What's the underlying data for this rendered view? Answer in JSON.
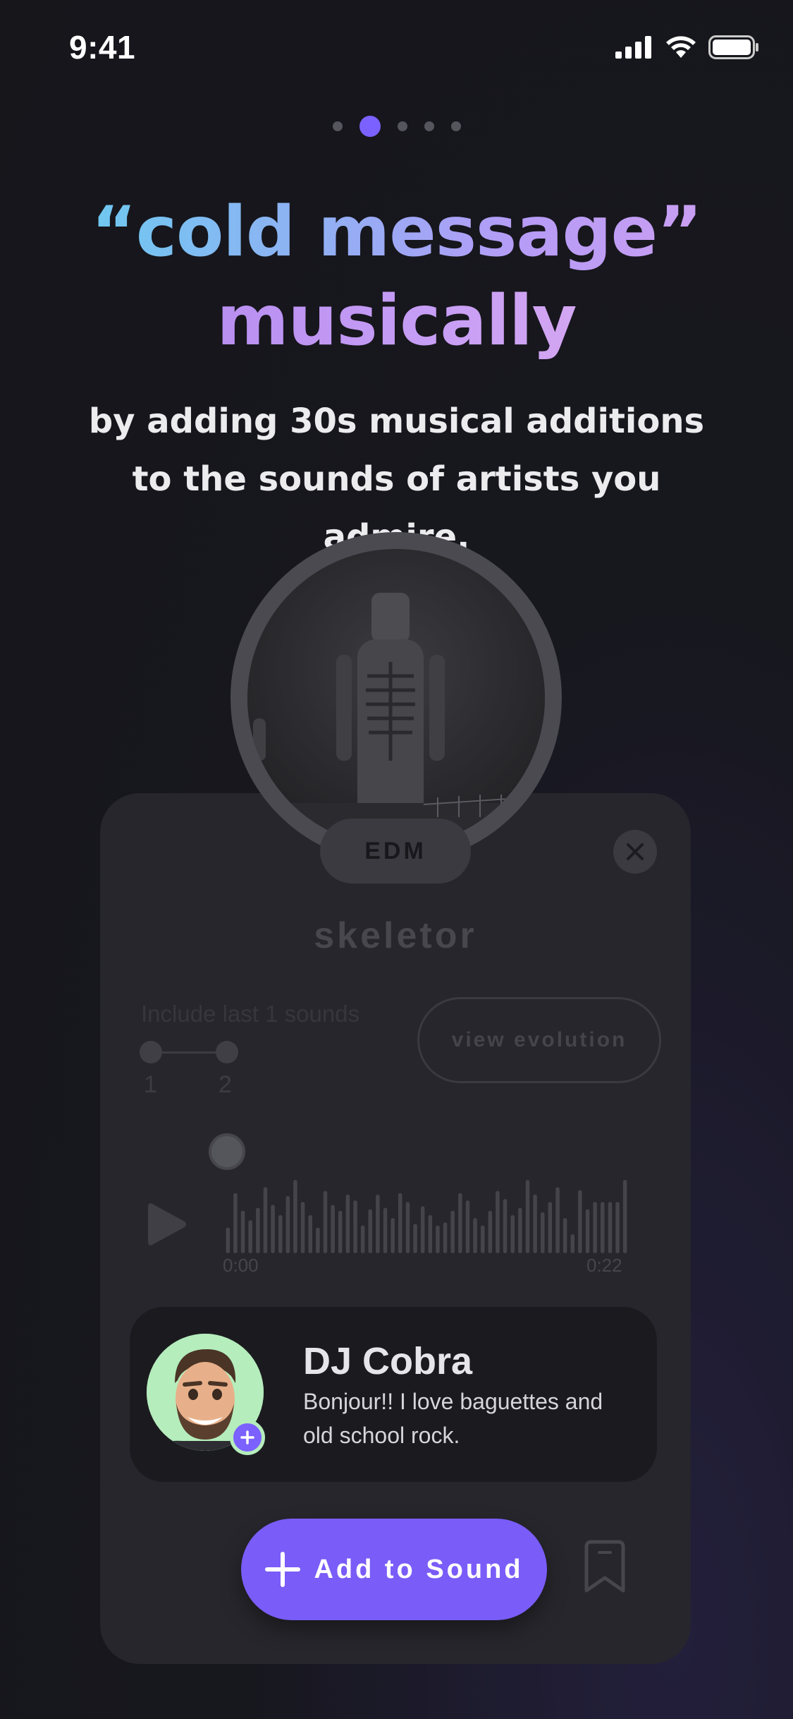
{
  "status_bar": {
    "time": "9:41"
  },
  "pagination": {
    "count": 5,
    "active_index": 1
  },
  "hero": {
    "title_line1": "“cold message”",
    "title_line2": "musically",
    "subtitle": "by adding 30s musical additions to the sounds of artists you admire."
  },
  "sound_card": {
    "genre": "EDM",
    "title": "skeletor",
    "include_label": "Include last 1 sounds",
    "slider_min": "1",
    "slider_max": "2",
    "view_evolution_label": "view evolution",
    "time_start": "0:00",
    "time_end": "0:22",
    "waveform_levels": [
      0.35,
      0.82,
      0.58,
      0.45,
      0.62,
      0.9,
      0.66,
      0.52,
      0.78,
      1.0,
      0.7,
      0.52,
      0.35,
      0.85,
      0.66,
      0.58,
      0.8,
      0.72,
      0.38,
      0.6,
      0.8,
      0.62,
      0.48,
      0.82,
      0.7,
      0.4,
      0.64,
      0.52,
      0.38,
      0.42,
      0.58,
      0.82,
      0.72,
      0.48,
      0.38,
      0.58,
      0.85,
      0.74,
      0.52,
      0.62,
      1.0,
      0.8,
      0.56,
      0.7,
      0.9,
      0.48,
      0.26,
      0.86,
      0.6,
      0.7,
      0.7,
      0.7,
      0.7,
      1.0
    ]
  },
  "artist": {
    "name": "DJ Cobra",
    "bio": "Bonjour!! I love baguettes and old school rock."
  },
  "actions": {
    "add_label": "Add to Sound"
  },
  "colors": {
    "accent": "#7b61ff",
    "card": "#26262c",
    "background": "#16161b"
  }
}
